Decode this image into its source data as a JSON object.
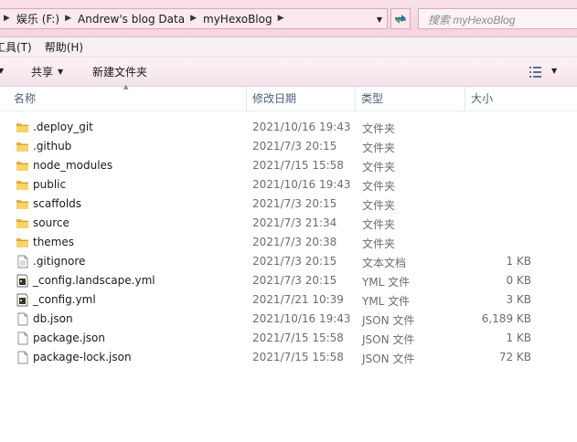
{
  "address": {
    "path": [
      "娱乐 (F:)",
      "Andrew's blog Data",
      "myHexoBlog"
    ],
    "search_placeholder": "搜索 myHexoBlog"
  },
  "menu": [
    "工具(T)",
    "帮助(H)"
  ],
  "toolbar": {
    "share_label": "共享",
    "new_folder_label": "新建文件夹"
  },
  "columns": {
    "name": "名称",
    "date": "修改日期",
    "type": "类型",
    "size": "大小"
  },
  "files": [
    {
      "name": ".deploy_git",
      "date": "2021/10/16 19:43",
      "type": "文件夹",
      "size": "",
      "icon": "folder-icon"
    },
    {
      "name": ".github",
      "date": "2021/7/3 20:15",
      "type": "文件夹",
      "size": "",
      "icon": "folder-icon"
    },
    {
      "name": "node_modules",
      "date": "2021/7/15 15:58",
      "type": "文件夹",
      "size": "",
      "icon": "folder-icon"
    },
    {
      "name": "public",
      "date": "2021/10/16 19:43",
      "type": "文件夹",
      "size": "",
      "icon": "folder-icon"
    },
    {
      "name": "scaffolds",
      "date": "2021/7/3 20:15",
      "type": "文件夹",
      "size": "",
      "icon": "folder-icon"
    },
    {
      "name": "source",
      "date": "2021/7/3 21:34",
      "type": "文件夹",
      "size": "",
      "icon": "folder-icon"
    },
    {
      "name": "themes",
      "date": "2021/7/3 20:38",
      "type": "文件夹",
      "size": "",
      "icon": "folder-icon"
    },
    {
      "name": ".gitignore",
      "date": "2021/7/3 20:15",
      "type": "文本文档",
      "size": "1 KB",
      "icon": "text-file-icon"
    },
    {
      "name": "_config.landscape.yml",
      "date": "2021/7/3 20:15",
      "type": "YML 文件",
      "size": "0 KB",
      "icon": "yml-file-icon"
    },
    {
      "name": "_config.yml",
      "date": "2021/7/21 10:39",
      "type": "YML 文件",
      "size": "3 KB",
      "icon": "yml-file-icon"
    },
    {
      "name": "db.json",
      "date": "2021/10/16 19:43",
      "type": "JSON 文件",
      "size": "6,189 KB",
      "icon": "file-icon"
    },
    {
      "name": "package.json",
      "date": "2021/7/15 15:58",
      "type": "JSON 文件",
      "size": "1 KB",
      "icon": "file-icon"
    },
    {
      "name": "package-lock.json",
      "date": "2021/7/15 15:58",
      "type": "JSON 文件",
      "size": "72 KB",
      "icon": "file-icon"
    }
  ]
}
